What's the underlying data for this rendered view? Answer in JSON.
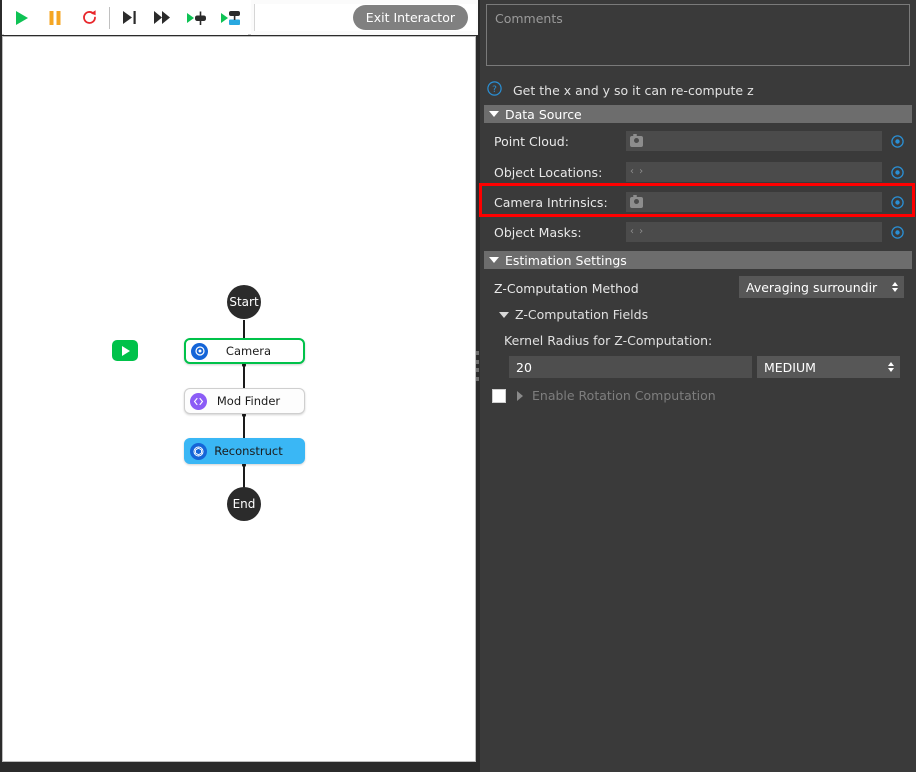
{
  "toolbar": {
    "buttons": [
      {
        "name": "play-button",
        "icon": "play-icon",
        "label": "Play"
      },
      {
        "name": "pause-button",
        "icon": "pause-icon",
        "label": "Pause"
      },
      {
        "name": "reset-button",
        "icon": "reload-icon",
        "label": "Reset"
      },
      {
        "name": "step-button",
        "icon": "step-forward-icon",
        "label": "Step"
      },
      {
        "name": "skip-button",
        "icon": "skip-forward-icon",
        "label": "Skip"
      },
      {
        "name": "run-to-node-button",
        "icon": "run-to-node-icon",
        "label": "Run To Node"
      },
      {
        "name": "run-to-breakpoint-button",
        "icon": "run-to-breakpoint-icon",
        "label": "Run To Breakpoint"
      }
    ],
    "exit_interactor_label": "Exit Interactor",
    "colors": {
      "play": "#0ec254",
      "pause": "#f5a623",
      "reset": "#e8262b",
      "step": "#2b2b2b",
      "exit_button_bg": "#808080"
    }
  },
  "graph": {
    "nodes": [
      {
        "id": "start",
        "label": "Start",
        "type": "terminal"
      },
      {
        "id": "camera",
        "label": "Camera",
        "type": "process",
        "icon": "camera-node-icon",
        "state": "active",
        "icon_color": "#1565d8"
      },
      {
        "id": "mod_finder",
        "label": "Mod Finder",
        "type": "process",
        "icon": "code-node-icon",
        "state": "normal",
        "icon_color": "#8b5cf6"
      },
      {
        "id": "reconstruct",
        "label": "Reconstruct",
        "type": "process",
        "icon": "cube-node-icon",
        "state": "selected",
        "icon_color": "#1565d8"
      },
      {
        "id": "end",
        "label": "End",
        "type": "terminal"
      }
    ],
    "run_badge": {
      "name": "run-node-badge",
      "icon": "play-icon",
      "color": "#00c24a"
    },
    "colors": {
      "active_outline": "#00c24a",
      "selected_fill": "#3ab7f5",
      "terminal_fill": "#2b2b2b"
    }
  },
  "panel": {
    "comments": {
      "value": "",
      "placeholder": "Comments"
    },
    "hint": {
      "icon": "help-circle-icon",
      "text": "Get the x and y so it can re-compute z"
    },
    "data_source": {
      "title": "Data Source",
      "expanded": true,
      "fields": [
        {
          "label": "Point Cloud:",
          "value": "",
          "glyph": "camera-glyph",
          "picker": "target-picker-icon",
          "highlighted": false
        },
        {
          "label": "Object Locations:",
          "value": "",
          "glyph": "bracket-glyph",
          "picker": "target-picker-icon",
          "highlighted": false
        },
        {
          "label": "Camera Intrinsics:",
          "value": "",
          "glyph": "camera-glyph",
          "picker": "target-picker-icon",
          "highlighted": true
        },
        {
          "label": "Object Masks:",
          "value": "",
          "glyph": "bracket-glyph",
          "picker": "target-picker-icon",
          "highlighted": false
        }
      ]
    },
    "estimation_settings": {
      "title": "Estimation Settings",
      "expanded": true,
      "z_method": {
        "label": "Z-Computation Method",
        "value": "Averaging surroundir"
      },
      "z_fields": {
        "title": "Z-Computation Fields",
        "expanded": true,
        "kernel_radius": {
          "label": "Kernel Radius for Z-Computation:",
          "value": "20",
          "unit": "MEDIUM"
        }
      },
      "rotation": {
        "label": "Enable Rotation Computation",
        "checked": false,
        "enabled": false
      }
    },
    "highlight_color": "#ff0000"
  }
}
